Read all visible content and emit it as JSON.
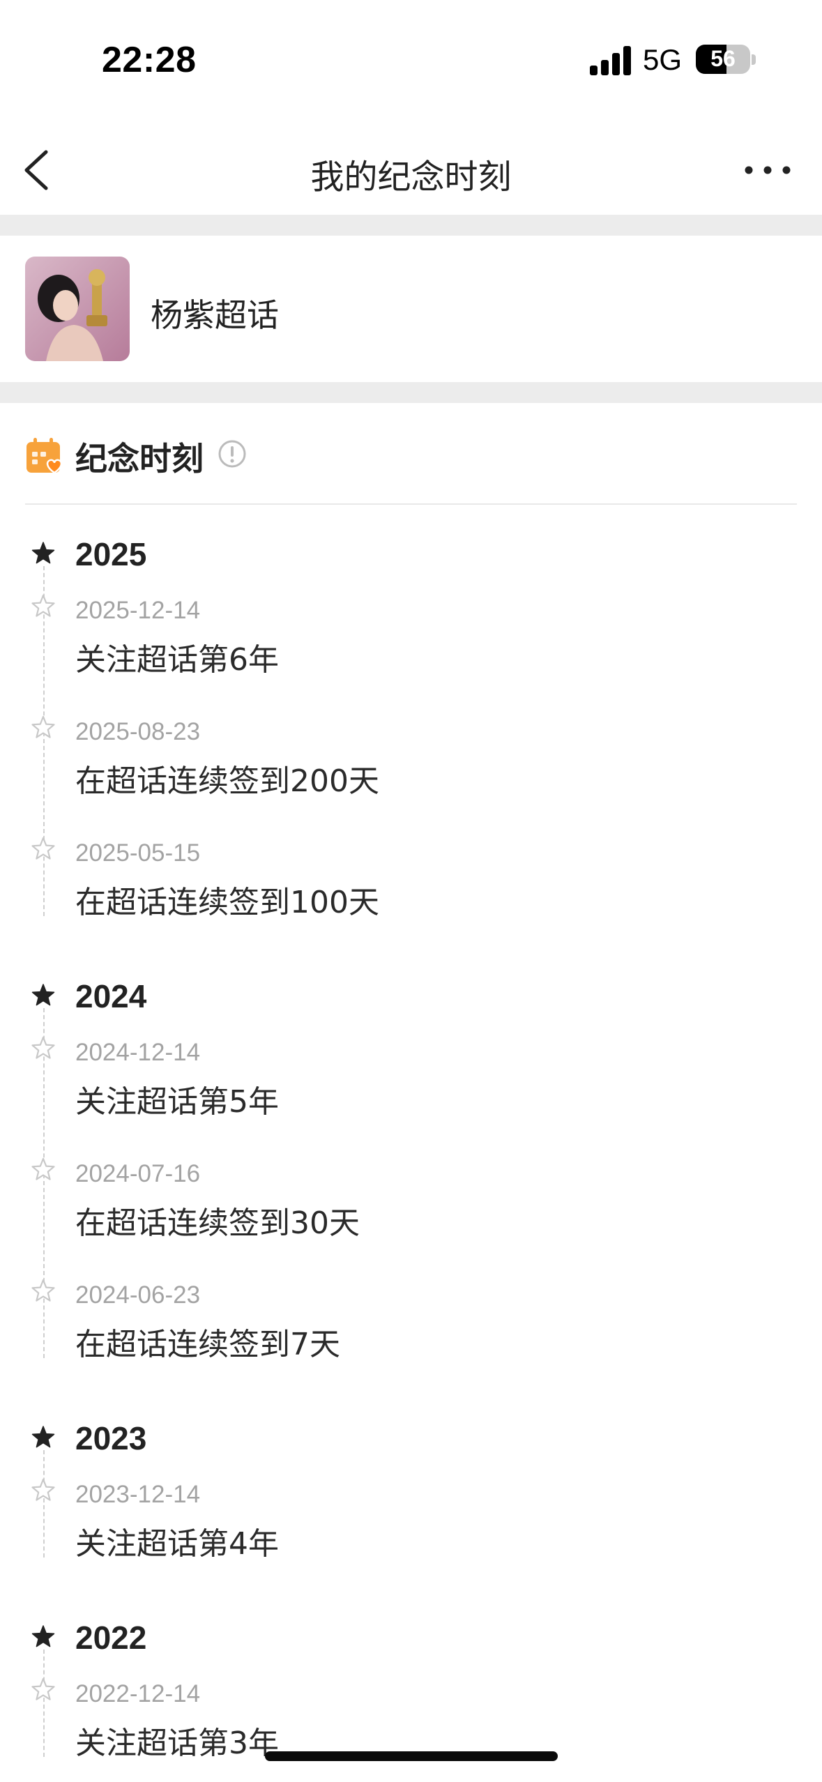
{
  "status_bar": {
    "time": "22:28",
    "network": "5G",
    "battery_level": "56",
    "signal_icon": "cellular-signal-icon"
  },
  "nav": {
    "title": "我的纪念时刻",
    "back_icon": "chevron-left-icon",
    "more_icon": "more-horizontal-icon"
  },
  "community": {
    "name": "杨紫超话",
    "avatar_icon": "community-avatar"
  },
  "section": {
    "title": "纪念时刻",
    "icon": "calendar-heart-icon",
    "info_icon": "info-circle-icon"
  },
  "colors": {
    "accent_orange": "#f7a23b",
    "separator_gray": "#ececec",
    "date_gray": "#a3a3a3",
    "text_dark": "#222222"
  },
  "timeline": [
    {
      "year": "2025",
      "events": [
        {
          "date": "2025-12-14",
          "text": "关注超话第6年"
        },
        {
          "date": "2025-08-23",
          "text": "在超话连续签到200天"
        },
        {
          "date": "2025-05-15",
          "text": "在超话连续签到100天"
        }
      ]
    },
    {
      "year": "2024",
      "events": [
        {
          "date": "2024-12-14",
          "text": "关注超话第5年"
        },
        {
          "date": "2024-07-16",
          "text": "在超话连续签到30天"
        },
        {
          "date": "2024-06-23",
          "text": "在超话连续签到7天"
        }
      ]
    },
    {
      "year": "2023",
      "events": [
        {
          "date": "2023-12-14",
          "text": "关注超话第4年"
        }
      ]
    },
    {
      "year": "2022",
      "events": [
        {
          "date": "2022-12-14",
          "text": "关注超话第3年"
        }
      ]
    }
  ]
}
